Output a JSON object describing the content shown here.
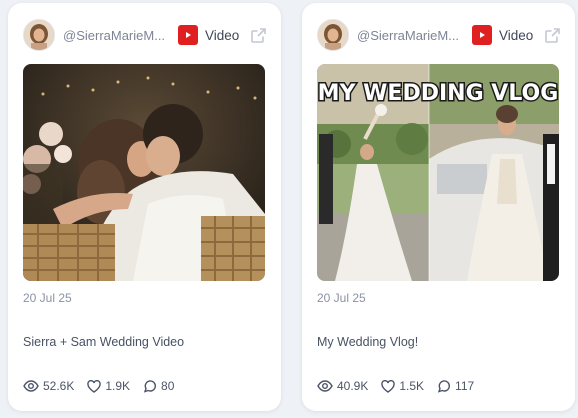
{
  "cards": [
    {
      "handle": "@SierraMarieM...",
      "source_label": "Video",
      "source_icon": "youtube-icon",
      "date": "20 Jul 25",
      "title": "Sierra + Sam Wedding Video",
      "views": "52.6K",
      "likes": "1.9K",
      "comments": "80"
    },
    {
      "handle": "@SierraMarieM...",
      "source_label": "Video",
      "source_icon": "youtube-icon",
      "date": "20 Jul 25",
      "title": "My Wedding Vlog!",
      "views": "40.9K",
      "likes": "1.5K",
      "comments": "117",
      "thumbnail_caption": "MY WEDDING VLOG"
    }
  ],
  "colors": {
    "youtube_red": "#e02020",
    "card_bg": "#ffffff",
    "page_bg": "#eef1f5",
    "muted_text": "#8a93a3"
  }
}
